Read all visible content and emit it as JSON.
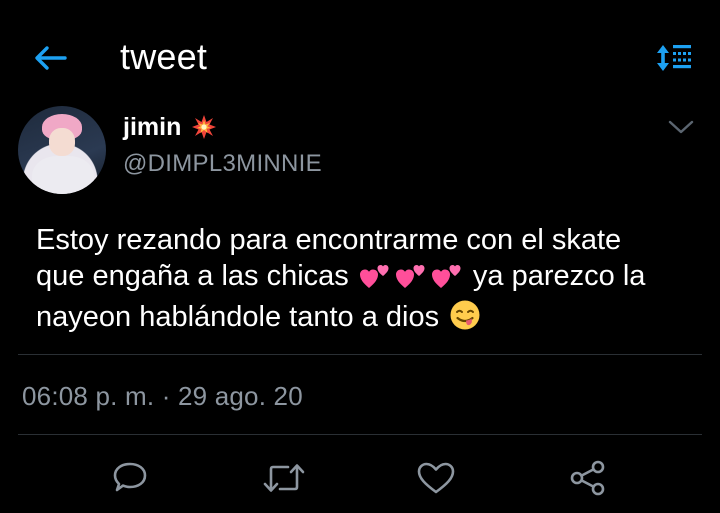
{
  "header": {
    "title": "tweet",
    "back_icon": "arrow-left-icon",
    "sort_icon": "sort-icon",
    "accent_color": "#1da1f2"
  },
  "author": {
    "name": "jimin",
    "badge_icon": "collision-emoji-icon",
    "handle": "@DIMPL3MINNIE",
    "menu_icon": "chevron-down-icon"
  },
  "tweet": {
    "lines": [
      {
        "text": "Estoy rezando para encontrarme con el skate"
      },
      {
        "text_before": "que engaña a las chicas",
        "emoji": [
          "two-hearts-icon",
          "two-hearts-icon",
          "two-hearts-icon"
        ],
        "text_after": "ya parezco la"
      },
      {
        "text": "nayeon hablándole tanto a dios",
        "emoji": [
          "face-savoring-food-icon"
        ]
      }
    ],
    "timestamp": "06:08 p. m. · 29 ago. 20"
  },
  "actions": [
    {
      "name": "reply",
      "icon": "reply-icon"
    },
    {
      "name": "retweet",
      "icon": "retweet-icon"
    },
    {
      "name": "like",
      "icon": "heart-icon"
    },
    {
      "name": "share",
      "icon": "share-icon"
    }
  ],
  "colors": {
    "background": "#000000",
    "text_primary": "#ffffff",
    "text_secondary": "#8d96a0",
    "divider": "#2a2f34",
    "heart_pink": "#ff4f9a"
  }
}
